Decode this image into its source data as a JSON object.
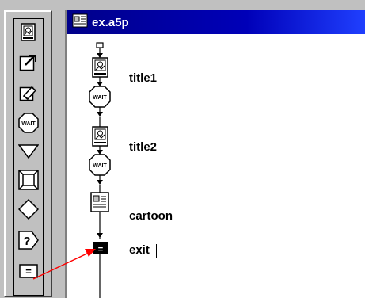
{
  "palette": {
    "tools": [
      {
        "icon": "display-icon"
      },
      {
        "icon": "motion-icon"
      },
      {
        "icon": "erase-icon"
      },
      {
        "icon": "wait-icon",
        "text": "WAIT"
      },
      {
        "icon": "navigate-icon"
      },
      {
        "icon": "framework-icon"
      },
      {
        "icon": "decision-icon"
      },
      {
        "icon": "interaction-icon",
        "text": "?"
      },
      {
        "icon": "calculation-icon",
        "text": "="
      }
    ]
  },
  "window": {
    "title": "ex.a5p",
    "icon": "flowline-window-icon"
  },
  "flowline": {
    "nodes": [
      {
        "type": "display",
        "label": "title1"
      },
      {
        "type": "wait",
        "text": "WAIT"
      },
      {
        "type": "display",
        "label": "title2"
      },
      {
        "type": "wait",
        "text": "WAIT"
      },
      {
        "type": "map",
        "label": "cartoon"
      },
      {
        "type": "calculation",
        "text": "=",
        "label": "exit"
      }
    ]
  },
  "colors": {
    "titlebar": "#00008a",
    "arrow": "#ff0000"
  }
}
